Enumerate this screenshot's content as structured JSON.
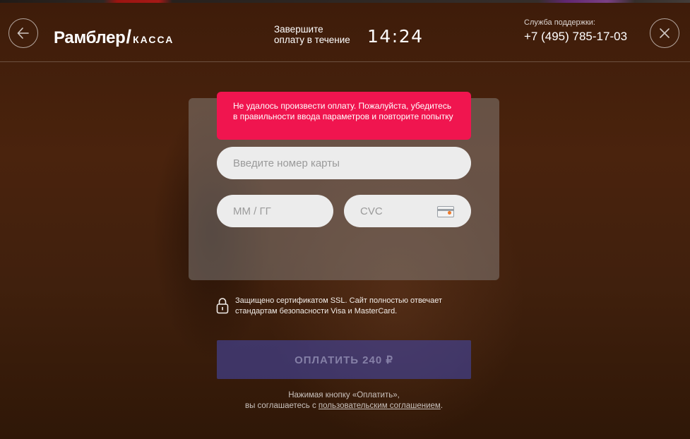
{
  "header": {
    "logo_main": "Рамблер",
    "logo_slash": "/",
    "logo_sub": "КАССА",
    "timer_label_line1": "Завершите",
    "timer_label_line2": "оплату в течение",
    "timer_value": "14:24",
    "support_label": "Служба поддержки:",
    "support_phone": "+7 (495) 785-17-03",
    "back_icon": "arrow-left-icon",
    "close_icon": "close-icon"
  },
  "form": {
    "error_message": "Не удалось произвести оплату. Пожалуйста, убедитесь в правильности ввода параметров и повторите попытку",
    "card_number_placeholder": "Введите номер карты",
    "expiry_placeholder": "ММ / ГГ",
    "cvc_placeholder": "CVC",
    "cvc_icon": "credit-card-icon",
    "ssl_icon": "lock-icon",
    "ssl_text": "Защищено сертификатом SSL. Сайт полностью отвечает стандартам безопасности Visa и MasterCard.",
    "pay_button": "ОПЛАТИТЬ 240 ₽"
  },
  "footer": {
    "agreement_line1": "Нажимая кнопку «Оплатить»,",
    "agreement_prefix": "вы соглашаетесь с ",
    "agreement_link": "пользовательским соглашением",
    "agreement_suffix": "."
  },
  "colors": {
    "error": "#f0154f",
    "pay_button": "#44469f"
  }
}
